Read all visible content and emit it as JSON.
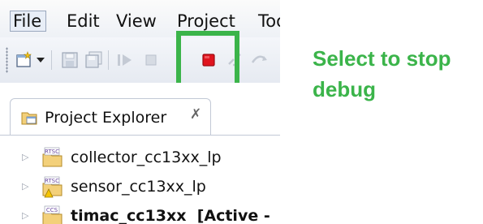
{
  "menu": {
    "file": "File",
    "edit": "Edit",
    "view": "View",
    "project": "Project",
    "tools": "Too"
  },
  "toolbar": {
    "icons": [
      "new-wizard-icon",
      "dropdown-arrow-icon",
      "save-icon",
      "save-all-icon",
      "resume-icon",
      "suspend-icon",
      "terminate-icon",
      "disconnect-icon",
      "step-icon"
    ],
    "terminate_color": "#e0141e"
  },
  "highlight_color": "#3bb44a",
  "project_explorer": {
    "tab_label": "Project Explorer",
    "close_glyph": "✗",
    "projects": [
      {
        "name": "collector_cc13xx_lp",
        "status": "",
        "icon": "rtsc-project-icon",
        "badge": "RTSC"
      },
      {
        "name": "sensor_cc13xx_lp",
        "status": "",
        "icon": "rtsc-project-warning-icon",
        "badge": "RTSC"
      },
      {
        "name": "timac_cc13xx",
        "status": "[Active -",
        "icon": "ccs-project-icon",
        "badge": "CCS"
      }
    ]
  },
  "callout": {
    "line1": "Select to stop",
    "line2": "debug"
  }
}
